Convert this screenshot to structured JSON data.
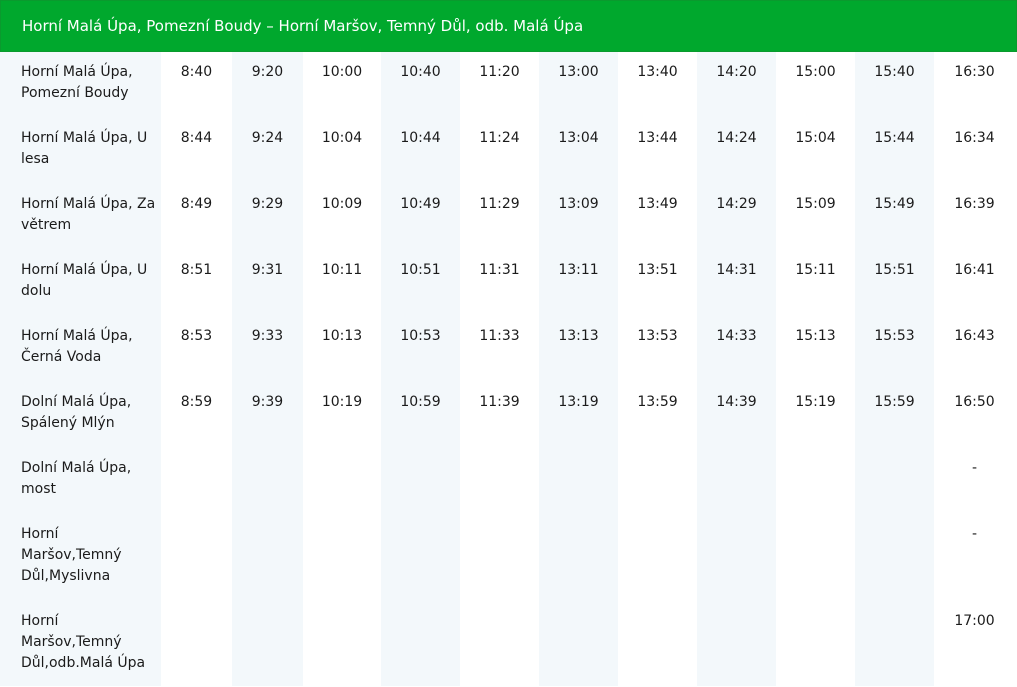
{
  "route": {
    "title": "Horní Malá Úpa, Pomezní Boudy – Horní Maršov, Temný Důl, odb. Malá Úpa"
  },
  "stops": [
    {
      "name": "Horní Malá Úpa, Pomezní Boudy",
      "times": [
        "8:40",
        "9:20",
        "10:00",
        "10:40",
        "11:20",
        "13:00",
        "13:40",
        "14:20",
        "15:00",
        "15:40",
        "16:30"
      ]
    },
    {
      "name": "Horní Malá Úpa, U lesa",
      "times": [
        "8:44",
        "9:24",
        "10:04",
        "10:44",
        "11:24",
        "13:04",
        "13:44",
        "14:24",
        "15:04",
        "15:44",
        "16:34"
      ]
    },
    {
      "name": "Horní Malá Úpa, Za větrem",
      "times": [
        "8:49",
        "9:29",
        "10:09",
        "10:49",
        "11:29",
        "13:09",
        "13:49",
        "14:29",
        "15:09",
        "15:49",
        "16:39"
      ]
    },
    {
      "name": "Horní Malá Úpa, U dolu",
      "times": [
        "8:51",
        "9:31",
        "10:11",
        "10:51",
        "11:31",
        "13:11",
        "13:51",
        "14:31",
        "15:11",
        "15:51",
        "16:41"
      ]
    },
    {
      "name": "Horní Malá Úpa, Černá Voda",
      "times": [
        "8:53",
        "9:33",
        "10:13",
        "10:53",
        "11:33",
        "13:13",
        "13:53",
        "14:33",
        "15:13",
        "15:53",
        "16:43"
      ]
    },
    {
      "name": "Dolní Malá Úpa, Spálený Mlýn",
      "times": [
        "8:59",
        "9:39",
        "10:19",
        "10:59",
        "11:39",
        "13:19",
        "13:59",
        "14:39",
        "15:19",
        "15:59",
        "16:50"
      ]
    },
    {
      "name": "Dolní Malá Úpa, most",
      "times": [
        "",
        "",
        "",
        "",
        "",
        "",
        "",
        "",
        "",
        "",
        "-"
      ]
    },
    {
      "name": "Horní Maršov,Temný Důl,Myslivna",
      "times": [
        "",
        "",
        "",
        "",
        "",
        "",
        "",
        "",
        "",
        "",
        "-"
      ]
    },
    {
      "name": "Horní Maršov,Temný Důl,odb.Malá Úpa",
      "times": [
        "",
        "",
        "",
        "",
        "",
        "",
        "",
        "",
        "",
        "",
        "17:00"
      ]
    }
  ]
}
